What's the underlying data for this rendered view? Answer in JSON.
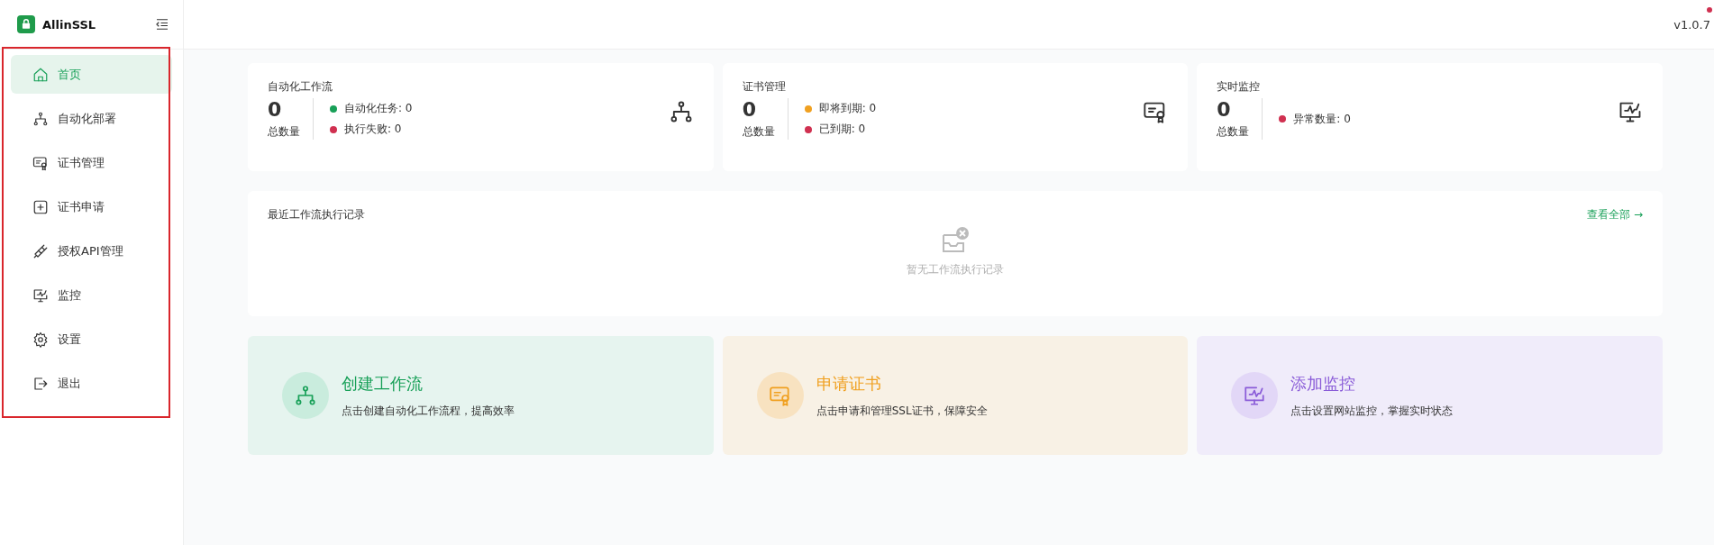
{
  "brand": {
    "name": "AllinSSL"
  },
  "version": "v1.0.7",
  "sidebar": {
    "items": [
      {
        "label": "首页",
        "kind": "home",
        "selected": true
      },
      {
        "label": "自动化部署",
        "kind": "flow",
        "selected": false
      },
      {
        "label": "证书管理",
        "kind": "cert",
        "selected": false
      },
      {
        "label": "证书申请",
        "kind": "plus",
        "selected": false
      },
      {
        "label": "授权API管理",
        "kind": "plug",
        "selected": false
      },
      {
        "label": "监控",
        "kind": "monitor",
        "selected": false
      },
      {
        "label": "设置",
        "kind": "gear",
        "selected": false
      },
      {
        "label": "退出",
        "kind": "logout",
        "selected": false
      }
    ]
  },
  "stats": [
    {
      "title": "自动化工作流",
      "value": "0",
      "value_label": "总数量",
      "kind": "flow",
      "items": [
        {
          "label": "自动化任务: 0",
          "color": "#18a058"
        },
        {
          "label": "执行失败: 0",
          "color": "#d03050"
        }
      ]
    },
    {
      "title": "证书管理",
      "value": "0",
      "value_label": "总数量",
      "kind": "cert",
      "items": [
        {
          "label": "即将到期: 0",
          "color": "#f0a020"
        },
        {
          "label": "已到期: 0",
          "color": "#d03050"
        }
      ]
    },
    {
      "title": "实时监控",
      "value": "0",
      "value_label": "总数量",
      "kind": "monitor",
      "items": [
        {
          "label": "异常数量: 0",
          "color": "#d03050"
        }
      ]
    }
  ],
  "recent": {
    "title": "最近工作流执行记录",
    "link": "查看全部 →",
    "empty_text": "暂无工作流执行记录"
  },
  "actions": [
    {
      "title": "创建工作流",
      "description": "点击创建自动化工作流程，提高效率",
      "kind": "flow"
    },
    {
      "title": "申请证书",
      "description": "点击申请和管理SSL证书，保障安全",
      "kind": "cert"
    },
    {
      "title": "添加监控",
      "description": "点击设置网站监控，掌握实时状态",
      "kind": "monitor"
    }
  ]
}
